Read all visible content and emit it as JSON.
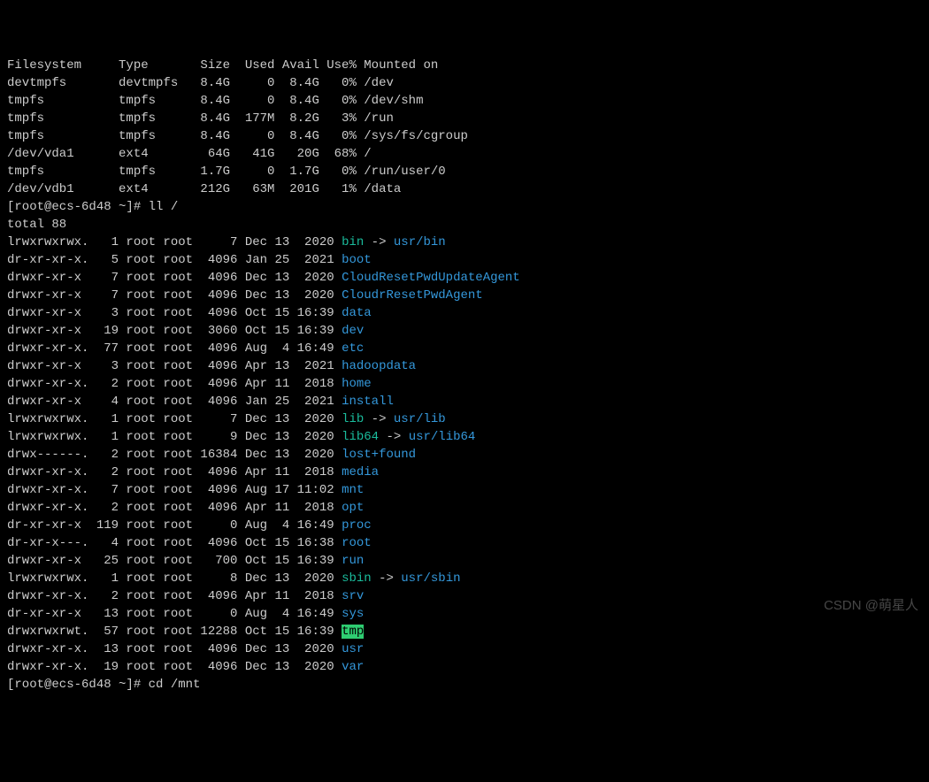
{
  "df": {
    "header": [
      "Filesystem",
      "Type",
      "Size",
      "Used",
      "Avail",
      "Use%",
      "Mounted on"
    ],
    "rows": [
      [
        "devtmpfs",
        "devtmpfs",
        "8.4G",
        "0",
        "8.4G",
        "0%",
        "/dev"
      ],
      [
        "tmpfs",
        "tmpfs",
        "8.4G",
        "0",
        "8.4G",
        "0%",
        "/dev/shm"
      ],
      [
        "tmpfs",
        "tmpfs",
        "8.4G",
        "177M",
        "8.2G",
        "3%",
        "/run"
      ],
      [
        "tmpfs",
        "tmpfs",
        "8.4G",
        "0",
        "8.4G",
        "0%",
        "/sys/fs/cgroup"
      ],
      [
        "/dev/vda1",
        "ext4",
        "64G",
        "41G",
        "20G",
        "68%",
        "/"
      ],
      [
        "tmpfs",
        "tmpfs",
        "1.7G",
        "0",
        "1.7G",
        "0%",
        "/run/user/0"
      ],
      [
        "/dev/vdb1",
        "ext4",
        "212G",
        "63M",
        "201G",
        "1%",
        "/data"
      ]
    ]
  },
  "prompt1": {
    "user": "root",
    "host": "ecs-6d48",
    "path": "~",
    "cmd": "ll /"
  },
  "total": "total 88",
  "ll": [
    {
      "perm": "lrwxrwxrwx.",
      "n": "1",
      "o": "root",
      "g": "root",
      "sz": "7",
      "date": "Dec 13  2020",
      "name": "bin",
      "type": "link",
      "target": "usr/bin"
    },
    {
      "perm": "dr-xr-xr-x.",
      "n": "5",
      "o": "root",
      "g": "root",
      "sz": "4096",
      "date": "Jan 25  2021",
      "name": "boot",
      "type": "dir"
    },
    {
      "perm": "drwxr-xr-x",
      "n": "7",
      "o": "root",
      "g": "root",
      "sz": "4096",
      "date": "Dec 13  2020",
      "name": "CloudResetPwdUpdateAgent",
      "type": "dir"
    },
    {
      "perm": "drwxr-xr-x",
      "n": "7",
      "o": "root",
      "g": "root",
      "sz": "4096",
      "date": "Dec 13  2020",
      "name": "CloudrResetPwdAgent",
      "type": "dir"
    },
    {
      "perm": "drwxr-xr-x",
      "n": "3",
      "o": "root",
      "g": "root",
      "sz": "4096",
      "date": "Oct 15 16:39",
      "name": "data",
      "type": "dir"
    },
    {
      "perm": "drwxr-xr-x",
      "n": "19",
      "o": "root",
      "g": "root",
      "sz": "3060",
      "date": "Oct 15 16:39",
      "name": "dev",
      "type": "dir"
    },
    {
      "perm": "drwxr-xr-x.",
      "n": "77",
      "o": "root",
      "g": "root",
      "sz": "4096",
      "date": "Aug  4 16:49",
      "name": "etc",
      "type": "dir"
    },
    {
      "perm": "drwxr-xr-x",
      "n": "3",
      "o": "root",
      "g": "root",
      "sz": "4096",
      "date": "Apr 13  2021",
      "name": "hadoopdata",
      "type": "dir"
    },
    {
      "perm": "drwxr-xr-x.",
      "n": "2",
      "o": "root",
      "g": "root",
      "sz": "4096",
      "date": "Apr 11  2018",
      "name": "home",
      "type": "dir"
    },
    {
      "perm": "drwxr-xr-x",
      "n": "4",
      "o": "root",
      "g": "root",
      "sz": "4096",
      "date": "Jan 25  2021",
      "name": "install",
      "type": "dir"
    },
    {
      "perm": "lrwxrwxrwx.",
      "n": "1",
      "o": "root",
      "g": "root",
      "sz": "7",
      "date": "Dec 13  2020",
      "name": "lib",
      "type": "link",
      "target": "usr/lib"
    },
    {
      "perm": "lrwxrwxrwx.",
      "n": "1",
      "o": "root",
      "g": "root",
      "sz": "9",
      "date": "Dec 13  2020",
      "name": "lib64",
      "type": "link",
      "target": "usr/lib64"
    },
    {
      "perm": "drwx------.",
      "n": "2",
      "o": "root",
      "g": "root",
      "sz": "16384",
      "date": "Dec 13  2020",
      "name": "lost+found",
      "type": "dir"
    },
    {
      "perm": "drwxr-xr-x.",
      "n": "2",
      "o": "root",
      "g": "root",
      "sz": "4096",
      "date": "Apr 11  2018",
      "name": "media",
      "type": "dir"
    },
    {
      "perm": "drwxr-xr-x.",
      "n": "7",
      "o": "root",
      "g": "root",
      "sz": "4096",
      "date": "Aug 17 11:02",
      "name": "mnt",
      "type": "dir"
    },
    {
      "perm": "drwxr-xr-x.",
      "n": "2",
      "o": "root",
      "g": "root",
      "sz": "4096",
      "date": "Apr 11  2018",
      "name": "opt",
      "type": "dir"
    },
    {
      "perm": "dr-xr-xr-x",
      "n": "119",
      "o": "root",
      "g": "root",
      "sz": "0",
      "date": "Aug  4 16:49",
      "name": "proc",
      "type": "dir"
    },
    {
      "perm": "dr-xr-x---.",
      "n": "4",
      "o": "root",
      "g": "root",
      "sz": "4096",
      "date": "Oct 15 16:38",
      "name": "root",
      "type": "dir"
    },
    {
      "perm": "drwxr-xr-x",
      "n": "25",
      "o": "root",
      "g": "root",
      "sz": "700",
      "date": "Oct 15 16:39",
      "name": "run",
      "type": "dir"
    },
    {
      "perm": "lrwxrwxrwx.",
      "n": "1",
      "o": "root",
      "g": "root",
      "sz": "8",
      "date": "Dec 13  2020",
      "name": "sbin",
      "type": "link",
      "target": "usr/sbin"
    },
    {
      "perm": "drwxr-xr-x.",
      "n": "2",
      "o": "root",
      "g": "root",
      "sz": "4096",
      "date": "Apr 11  2018",
      "name": "srv",
      "type": "dir"
    },
    {
      "perm": "dr-xr-xr-x",
      "n": "13",
      "o": "root",
      "g": "root",
      "sz": "0",
      "date": "Aug  4 16:49",
      "name": "sys",
      "type": "dir"
    },
    {
      "perm": "drwxrwxrwt.",
      "n": "57",
      "o": "root",
      "g": "root",
      "sz": "12288",
      "date": "Oct 15 16:39",
      "name": "tmp",
      "type": "sticky"
    },
    {
      "perm": "drwxr-xr-x.",
      "n": "13",
      "o": "root",
      "g": "root",
      "sz": "4096",
      "date": "Dec 13  2020",
      "name": "usr",
      "type": "dir"
    },
    {
      "perm": "drwxr-xr-x.",
      "n": "19",
      "o": "root",
      "g": "root",
      "sz": "4096",
      "date": "Dec 13  2020",
      "name": "var",
      "type": "dir"
    }
  ],
  "prompt2": {
    "user": "root",
    "host": "ecs-6d48",
    "path": "~",
    "cmd": "cd /mnt"
  },
  "watermark": "CSDN @萌星人"
}
